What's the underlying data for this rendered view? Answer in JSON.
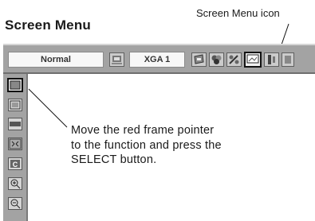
{
  "heading": "Screen Menu",
  "icon_caption": "Screen Menu icon",
  "menubar": {
    "mode_value": "Normal",
    "signal_value": "XGA 1",
    "icons": [
      "screen-size-icon",
      "image-icon",
      "color-icon",
      "setting-icon",
      "screen-menu-icon",
      "info-icon",
      "extra-icon"
    ]
  },
  "side_menu": {
    "icons": [
      "normal-screen-icon",
      "true-screen-icon",
      "wide-screen-icon",
      "full-screen-icon",
      "custom-screen-icon",
      "digital-zoom-plus-icon",
      "digital-zoom-minus-icon"
    ]
  },
  "instruction": {
    "line1": "Move the red frame pointer",
    "line2": "to the function and press the",
    "line3": "SELECT button."
  },
  "colors": {
    "panel": "#a3a3a3",
    "field": "#f7f7f7",
    "text": "#1a1a1a"
  }
}
